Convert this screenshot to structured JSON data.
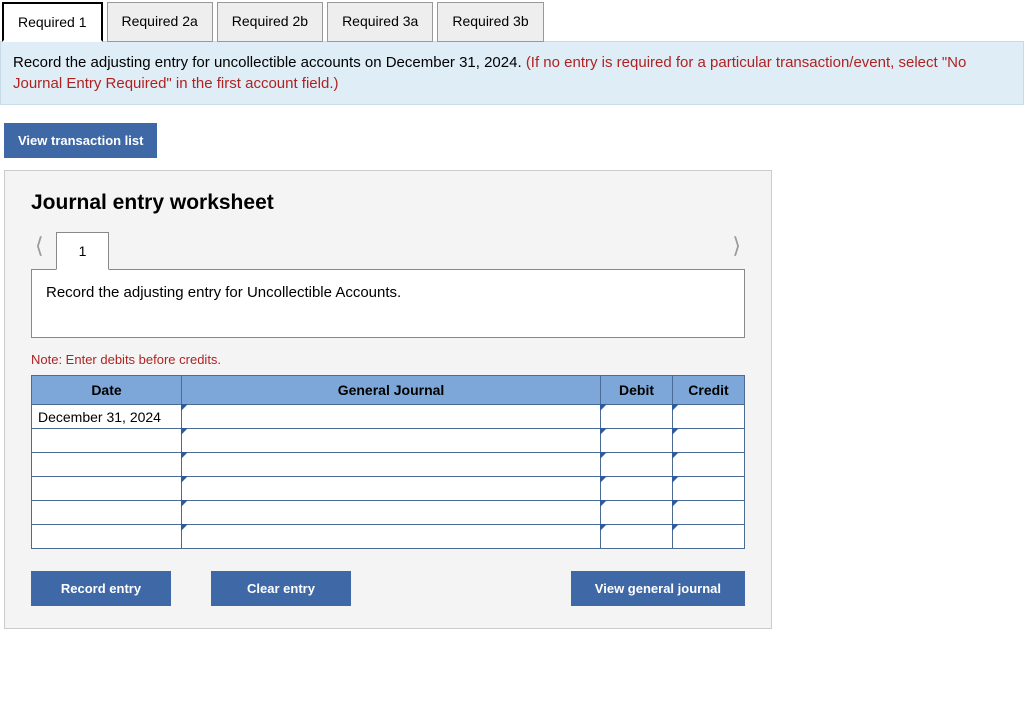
{
  "tabs": [
    {
      "label": "Required 1",
      "active": true
    },
    {
      "label": "Required 2a",
      "active": false
    },
    {
      "label": "Required 2b",
      "active": false
    },
    {
      "label": "Required 3a",
      "active": false
    },
    {
      "label": "Required 3b",
      "active": false
    }
  ],
  "instruction": {
    "main": "Record the adjusting entry for uncollectible accounts on December 31, 2024. ",
    "hint": "(If no entry is required for a particular transaction/event, select \"No Journal Entry Required\" in the first account field.)"
  },
  "view_txn_label": "View transaction list",
  "worksheet": {
    "title": "Journal entry worksheet",
    "page_number": "1",
    "description": "Record the adjusting entry for Uncollectible Accounts.",
    "note": "Note: Enter debits before credits.",
    "headers": {
      "date": "Date",
      "gj": "General Journal",
      "debit": "Debit",
      "credit": "Credit"
    },
    "rows": [
      {
        "date": "December 31, 2024",
        "gj": "",
        "debit": "",
        "credit": ""
      },
      {
        "date": "",
        "gj": "",
        "debit": "",
        "credit": ""
      },
      {
        "date": "",
        "gj": "",
        "debit": "",
        "credit": ""
      },
      {
        "date": "",
        "gj": "",
        "debit": "",
        "credit": ""
      },
      {
        "date": "",
        "gj": "",
        "debit": "",
        "credit": ""
      },
      {
        "date": "",
        "gj": "",
        "debit": "",
        "credit": ""
      }
    ],
    "buttons": {
      "record": "Record entry",
      "clear": "Clear entry",
      "view": "View general journal"
    }
  }
}
